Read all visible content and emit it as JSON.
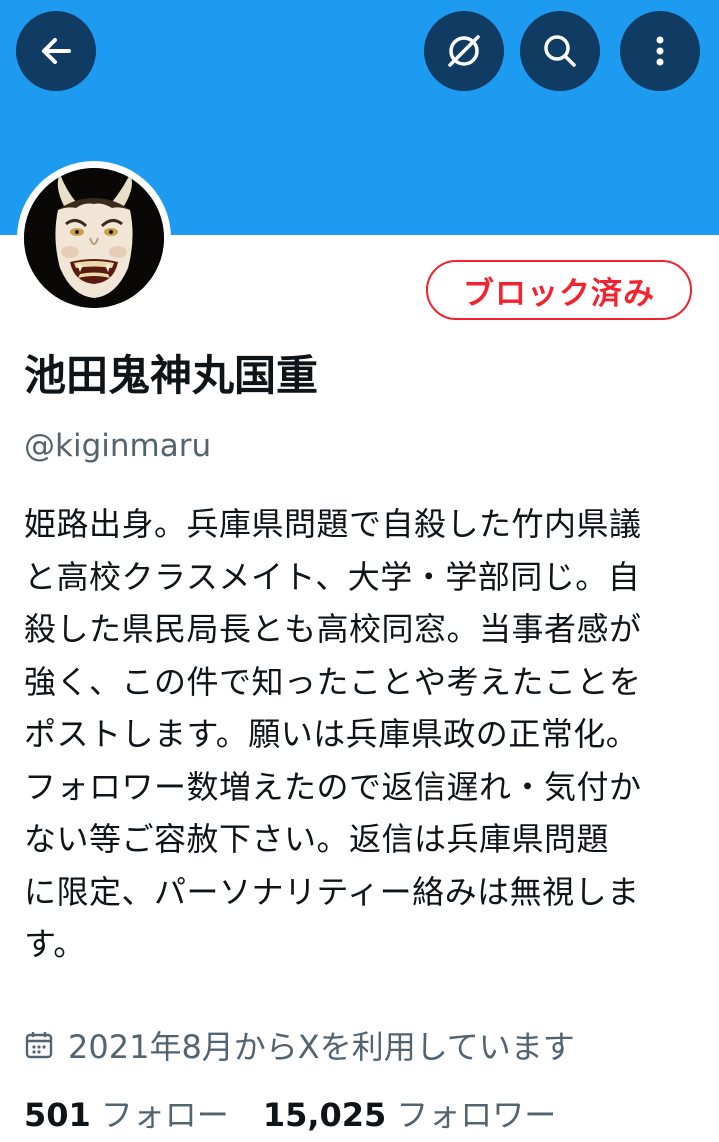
{
  "colors": {
    "banner": "#1d9bf0",
    "header_button_bg": "#103b63",
    "blocked_red": "#f4212e",
    "text_primary": "#0f1419",
    "text_secondary": "#536471"
  },
  "header": {
    "back_icon": "arrow-left-icon",
    "grok_icon": "grok-icon",
    "search_icon": "search-icon",
    "more_icon": "more-vertical-icon"
  },
  "profile": {
    "avatar": "hannya-mask-avatar",
    "blocked_label": "ブロック済み",
    "display_name": "池田鬼神丸国重",
    "handle": "@kiginmaru",
    "bio_lines": [
      "姫路出身。兵庫県問題で自殺した竹内県議",
      "と高校クラスメイト、大学・学部同じ。自",
      "殺した県民局長とも高校同窓。当事者感が",
      "強く、この件で知ったことや考えたことを",
      "ポストします。願いは兵庫県政の正常化。",
      "フォロワー数増えたので返信遅れ・気付か",
      "ない等ご容赦下さい。返信は兵庫県問題",
      "に限定、パーソナリティー絡みは無視しま",
      "す。"
    ],
    "joined_icon": "calendar-icon",
    "joined_text": "2021年8月からXを利用しています",
    "following_count": "501",
    "following_label": "フォロー",
    "followers_count": "15,025",
    "followers_label": "フォロワー"
  }
}
